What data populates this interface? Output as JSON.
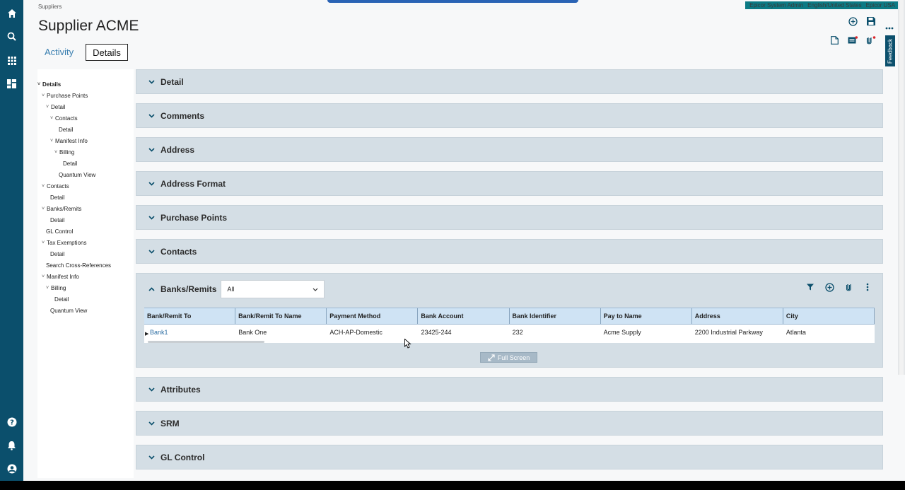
{
  "nav": {
    "icons": [
      "home-icon",
      "search-icon",
      "apps-grid-icon",
      "dashboard-icon",
      "help-icon",
      "bell-icon",
      "user-icon"
    ]
  },
  "topbar": {
    "items": [
      "Epicor System Admin",
      "English/United States",
      "Epicor USA"
    ]
  },
  "breadcrumb": "Suppliers",
  "title": "Supplier ACME",
  "tabs": [
    {
      "label": "Activity"
    },
    {
      "label": "Details"
    }
  ],
  "feedback_label": "Feedback",
  "tree": [
    {
      "label": "Details",
      "indent": 0,
      "chev": true
    },
    {
      "label": "Purchase Points",
      "indent": 1,
      "chev": true
    },
    {
      "label": "Detail",
      "indent": 2,
      "chev": true
    },
    {
      "label": "Contacts",
      "indent": 3,
      "chev": true
    },
    {
      "label": "Detail",
      "indent": 4,
      "chev": false
    },
    {
      "label": "Manifest Info",
      "indent": 3,
      "chev": true
    },
    {
      "label": "Billing",
      "indent": 4,
      "chev": true
    },
    {
      "label": "Detail",
      "indent": 5,
      "chev": false
    },
    {
      "label": "Quantum View",
      "indent": 4,
      "chev": false
    },
    {
      "label": "Contacts",
      "indent": 1,
      "chev": true
    },
    {
      "label": "Detail",
      "indent": 2,
      "chev": false
    },
    {
      "label": "Banks/Remits",
      "indent": 1,
      "chev": true
    },
    {
      "label": "Detail",
      "indent": 2,
      "chev": false
    },
    {
      "label": "GL Control",
      "indent": 1,
      "chev": false
    },
    {
      "label": "Tax Exemptions",
      "indent": 1,
      "chev": true
    },
    {
      "label": "Detail",
      "indent": 2,
      "chev": false
    },
    {
      "label": "Search Cross-References",
      "indent": 1,
      "chev": false
    },
    {
      "label": "Manifest Info",
      "indent": 1,
      "chev": true
    },
    {
      "label": "Billing",
      "indent": 2,
      "chev": true
    },
    {
      "label": "Detail",
      "indent": 3,
      "chev": false
    },
    {
      "label": "Quantum View",
      "indent": 2,
      "chev": false
    }
  ],
  "sections_before": [
    "Detail",
    "Comments",
    "Address",
    "Address Format",
    "Purchase Points",
    "Contacts"
  ],
  "banks": {
    "label": "Banks/Remits",
    "filter_value": "All",
    "columns": [
      "Bank/Remit To",
      "Bank/Remit To Name",
      "Payment Method",
      "Bank Account",
      "Bank Identifier",
      "Pay to Name",
      "Address",
      "City"
    ],
    "rows": [
      [
        "Bank1",
        "Bank One",
        "ACH-AP-Domestic",
        "23425-244",
        "232",
        "Acme Supply",
        "2200 Industrial Parkway",
        "Atlanta"
      ]
    ],
    "fullscreen_label": "Full Screen"
  },
  "sections_after": [
    "Attributes",
    "SRM",
    "GL Control"
  ],
  "colors": {
    "nav_bg": "#0b4f6c",
    "section_bg": "#d4dee5",
    "grid_header": "#cfe3f4",
    "link": "#2d6ea3"
  }
}
